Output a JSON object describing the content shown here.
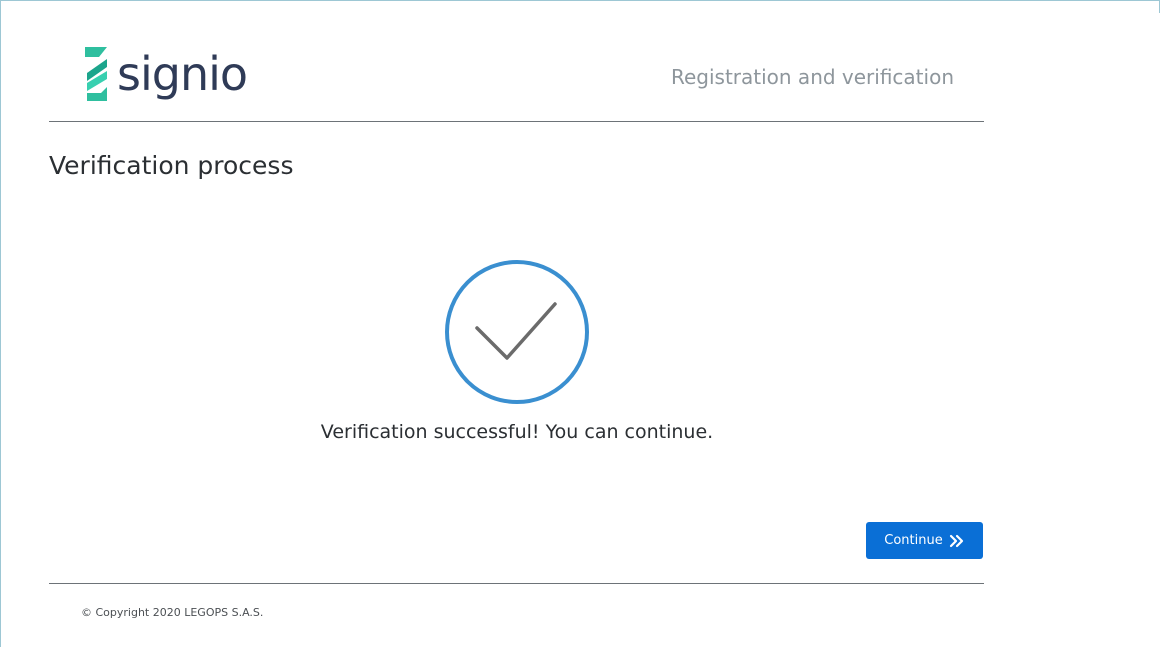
{
  "brand": {
    "name": "signio",
    "logo_icon": "signio-ribbon-logo"
  },
  "header": {
    "title": "Registration and verification"
  },
  "page": {
    "title": "Verification process"
  },
  "status": {
    "icon": "check-circle-icon",
    "message": "Verification successful! You can continue.",
    "accent_color": "#3a8fd0"
  },
  "actions": {
    "continue_label": "Continue",
    "continue_icon": "double-chevron-right-icon",
    "button_color": "#0a6fd6"
  },
  "footer": {
    "copyright": "© Copyright 2020 LEGOPS S.A.S."
  }
}
